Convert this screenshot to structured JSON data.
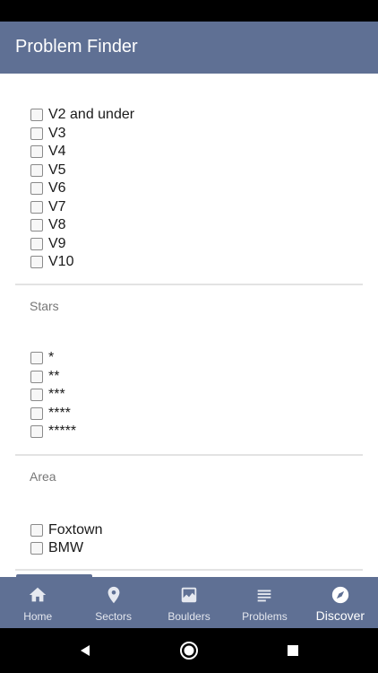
{
  "header": {
    "title": "Problem Finder"
  },
  "grades": [
    "V2 and under",
    "V3",
    "V4",
    "V5",
    "V6",
    "V7",
    "V8",
    "V9",
    "V10"
  ],
  "stars": {
    "title": "Stars",
    "options": [
      "*",
      "**",
      "***",
      "****",
      "*****"
    ]
  },
  "area": {
    "title": "Area",
    "options": [
      "Foxtown",
      "BMW"
    ]
  },
  "nav": {
    "items": [
      {
        "label": "Home",
        "icon": "home-icon"
      },
      {
        "label": "Sectors",
        "icon": "map-pin-icon"
      },
      {
        "label": "Boulders",
        "icon": "image-icon"
      },
      {
        "label": "Problems",
        "icon": "list-icon"
      },
      {
        "label": "Discover",
        "icon": "compass-icon"
      }
    ],
    "active": "Discover"
  },
  "colors": {
    "primary": "#5f7094",
    "background": "#ffffff",
    "divider": "#e3e3e3"
  }
}
